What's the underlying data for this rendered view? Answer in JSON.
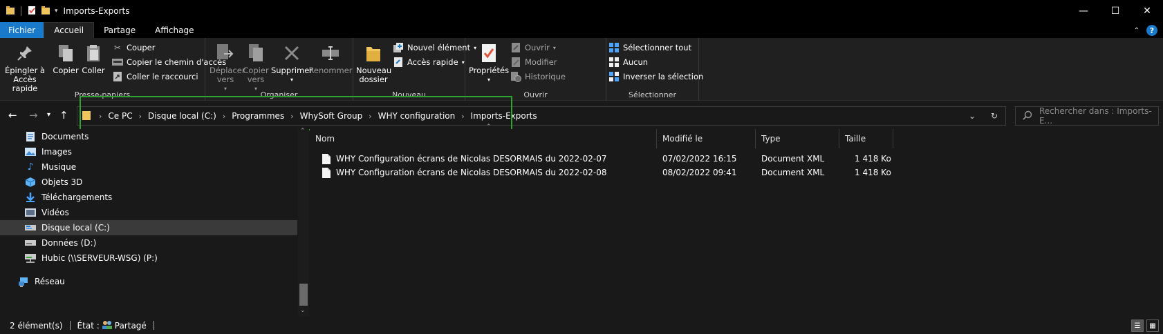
{
  "window": {
    "title": "Imports-Exports",
    "minimize": "—",
    "maximize": "☐",
    "close": "✕"
  },
  "tabs": [
    "Fichier",
    "Accueil",
    "Partage",
    "Affichage"
  ],
  "help_label": "?",
  "ribbon": {
    "clipboard": {
      "pin": "Épingler à Accès rapide",
      "copy": "Copier",
      "paste": "Coller",
      "cut": "Couper",
      "copy_path": "Copier le chemin d'accès",
      "paste_shortcut": "Coller le raccourci",
      "label": "Presse-papiers"
    },
    "organize": {
      "move_to": "Déplacer vers",
      "copy_to": "Copier vers",
      "delete": "Supprimer",
      "rename": "Renommer",
      "label": "Organiser"
    },
    "new": {
      "new_folder": "Nouveau dossier",
      "new_item": "Nouvel élément",
      "easy_access": "Accès rapide",
      "label": "Nouveau"
    },
    "open": {
      "properties": "Propriétés",
      "open": "Ouvrir",
      "edit": "Modifier",
      "history": "Historique",
      "label": "Ouvrir"
    },
    "select": {
      "select_all": "Sélectionner tout",
      "select_none": "Aucun",
      "invert": "Inverser la sélection",
      "label": "Sélectionner"
    }
  },
  "address": {
    "crumbs": [
      "Ce PC",
      "Disque local (C:)",
      "Programmes",
      "WhySoft Group",
      "WHY configuration",
      "Imports-Exports"
    ]
  },
  "search": {
    "placeholder": "Rechercher dans : Imports-E..."
  },
  "nav_pane": {
    "items": [
      {
        "label": "Documents",
        "icon": "documents-icon"
      },
      {
        "label": "Images",
        "icon": "images-icon"
      },
      {
        "label": "Musique",
        "icon": "music-icon"
      },
      {
        "label": "Objets 3D",
        "icon": "3d-objects-icon"
      },
      {
        "label": "Téléchargements",
        "icon": "downloads-icon"
      },
      {
        "label": "Vidéos",
        "icon": "videos-icon"
      },
      {
        "label": "Disque local (C:)",
        "icon": "drive-icon",
        "selected": true
      },
      {
        "label": "Données (D:)",
        "icon": "drive-icon"
      },
      {
        "label": "Hubic (\\\\SERVEUR-WSG) (P:)",
        "icon": "network-drive-icon"
      },
      {
        "label": "Réseau",
        "icon": "network-icon"
      }
    ]
  },
  "file_list": {
    "columns": [
      "Nom",
      "Modifié le",
      "Type",
      "Taille"
    ],
    "rows": [
      {
        "name": "WHY Configuration écrans de Nicolas DESORMAIS du 2022-02-07",
        "modified": "07/02/2022 16:15",
        "type": "Document XML",
        "size": "1 418 Ko"
      },
      {
        "name": "WHY Configuration écrans de Nicolas DESORMAIS du 2022-02-08",
        "modified": "08/02/2022 09:41",
        "type": "Document XML",
        "size": "1 418 Ko"
      }
    ]
  },
  "status": {
    "count": "2 élément(s)",
    "state_label": "État :",
    "state_value": "Partagé"
  },
  "colors": {
    "accent": "#1979ca",
    "highlight": "#2ea52e",
    "background": "#191919"
  }
}
